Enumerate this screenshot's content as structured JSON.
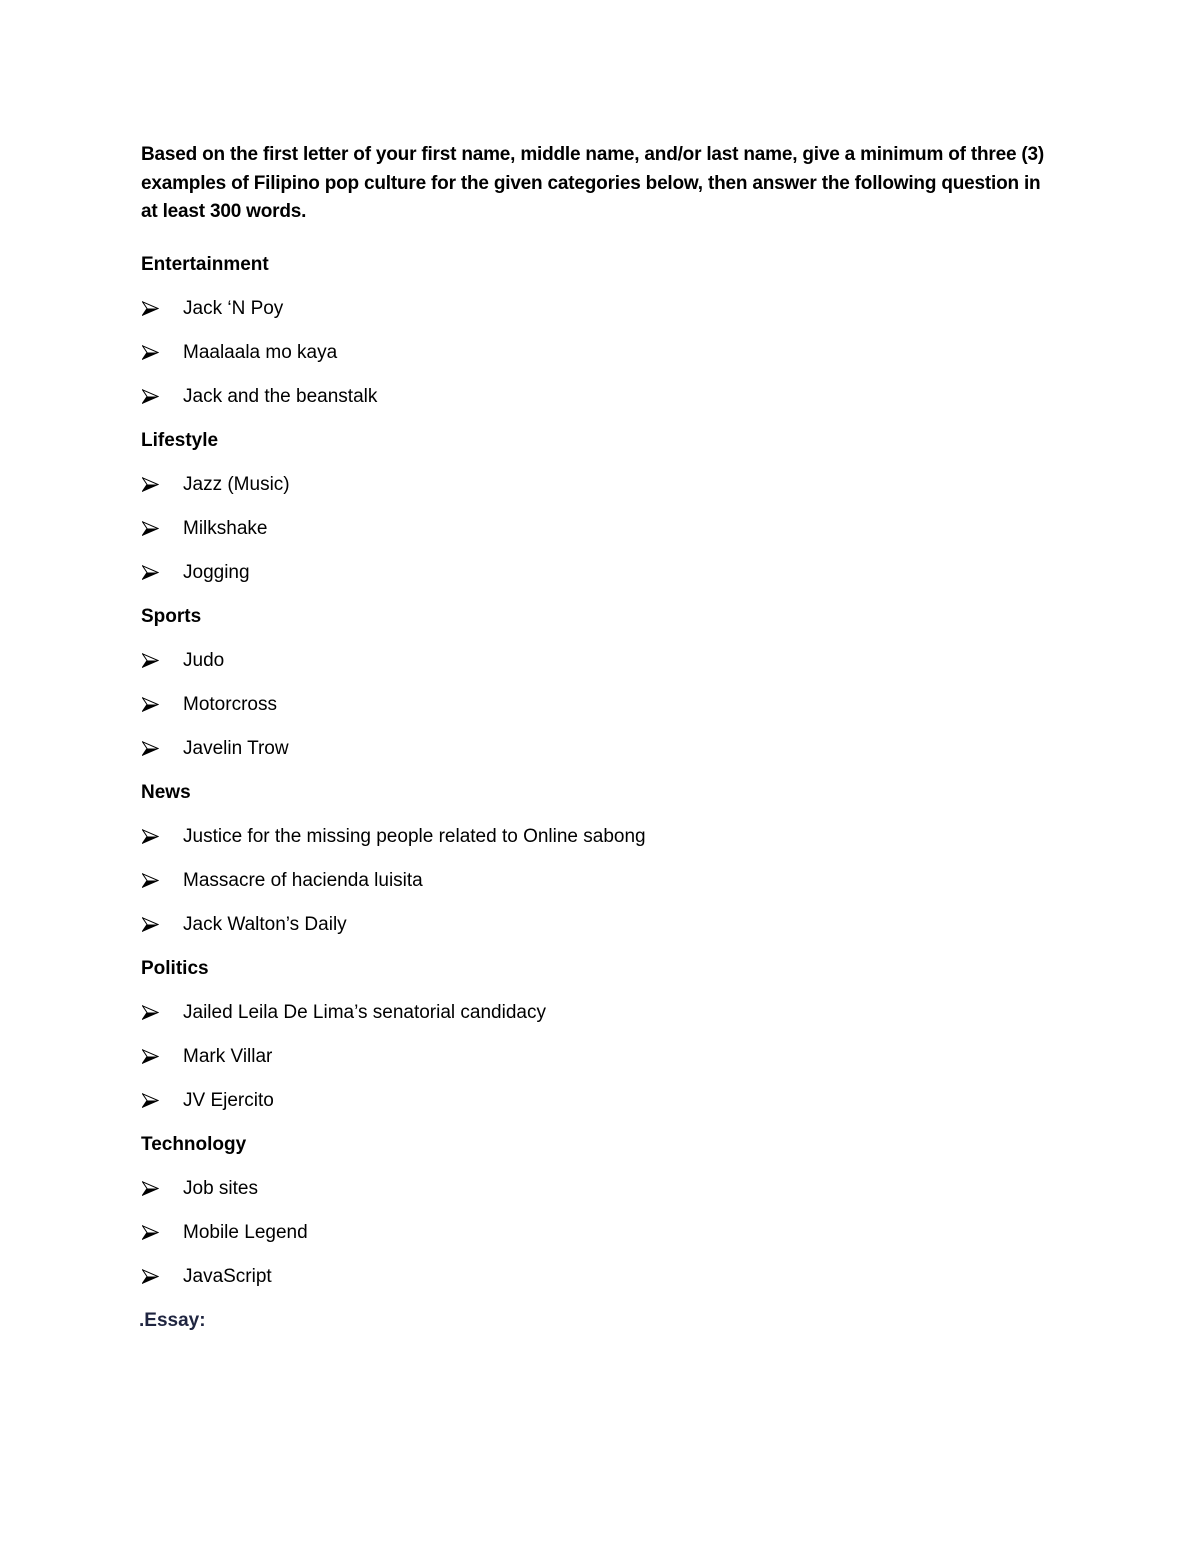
{
  "document": {
    "intro": "Based on the first letter of your first name, middle name, and/or last name, give a minimum of three (3) examples of Filipino pop culture for the given categories below, then answer the following question in at least 300 words.",
    "bullet_icon": "arrowhead-bullet",
    "sections": [
      {
        "heading": "Entertainment",
        "items": [
          "Jack ‘N Poy",
          "Maalaala mo kaya",
          "Jack and the beanstalk"
        ]
      },
      {
        "heading": "Lifestyle",
        "items": [
          "Jazz (Music)",
          "Milkshake",
          "Jogging"
        ]
      },
      {
        "heading": "Sports",
        "items": [
          "Judo",
          "Motorcross",
          "Javelin Trow"
        ]
      },
      {
        "heading": "News",
        "items": [
          "Justice for the missing people related to Online sabong",
          "Massacre of hacienda luisita",
          "Jack Walton’s Daily"
        ]
      },
      {
        "heading": "Politics",
        "items": [
          "Jailed Leila De Lima’s senatorial candidacy",
          "Mark Villar",
          "JV Ejercito"
        ]
      },
      {
        "heading": "Technology",
        "items": [
          "Job sites",
          "Mobile Legend",
          "JavaScript"
        ]
      }
    ],
    "essay_label": ".Essay:",
    "colors": {
      "text": "#000000",
      "essay_heading": "#1f2540"
    }
  }
}
